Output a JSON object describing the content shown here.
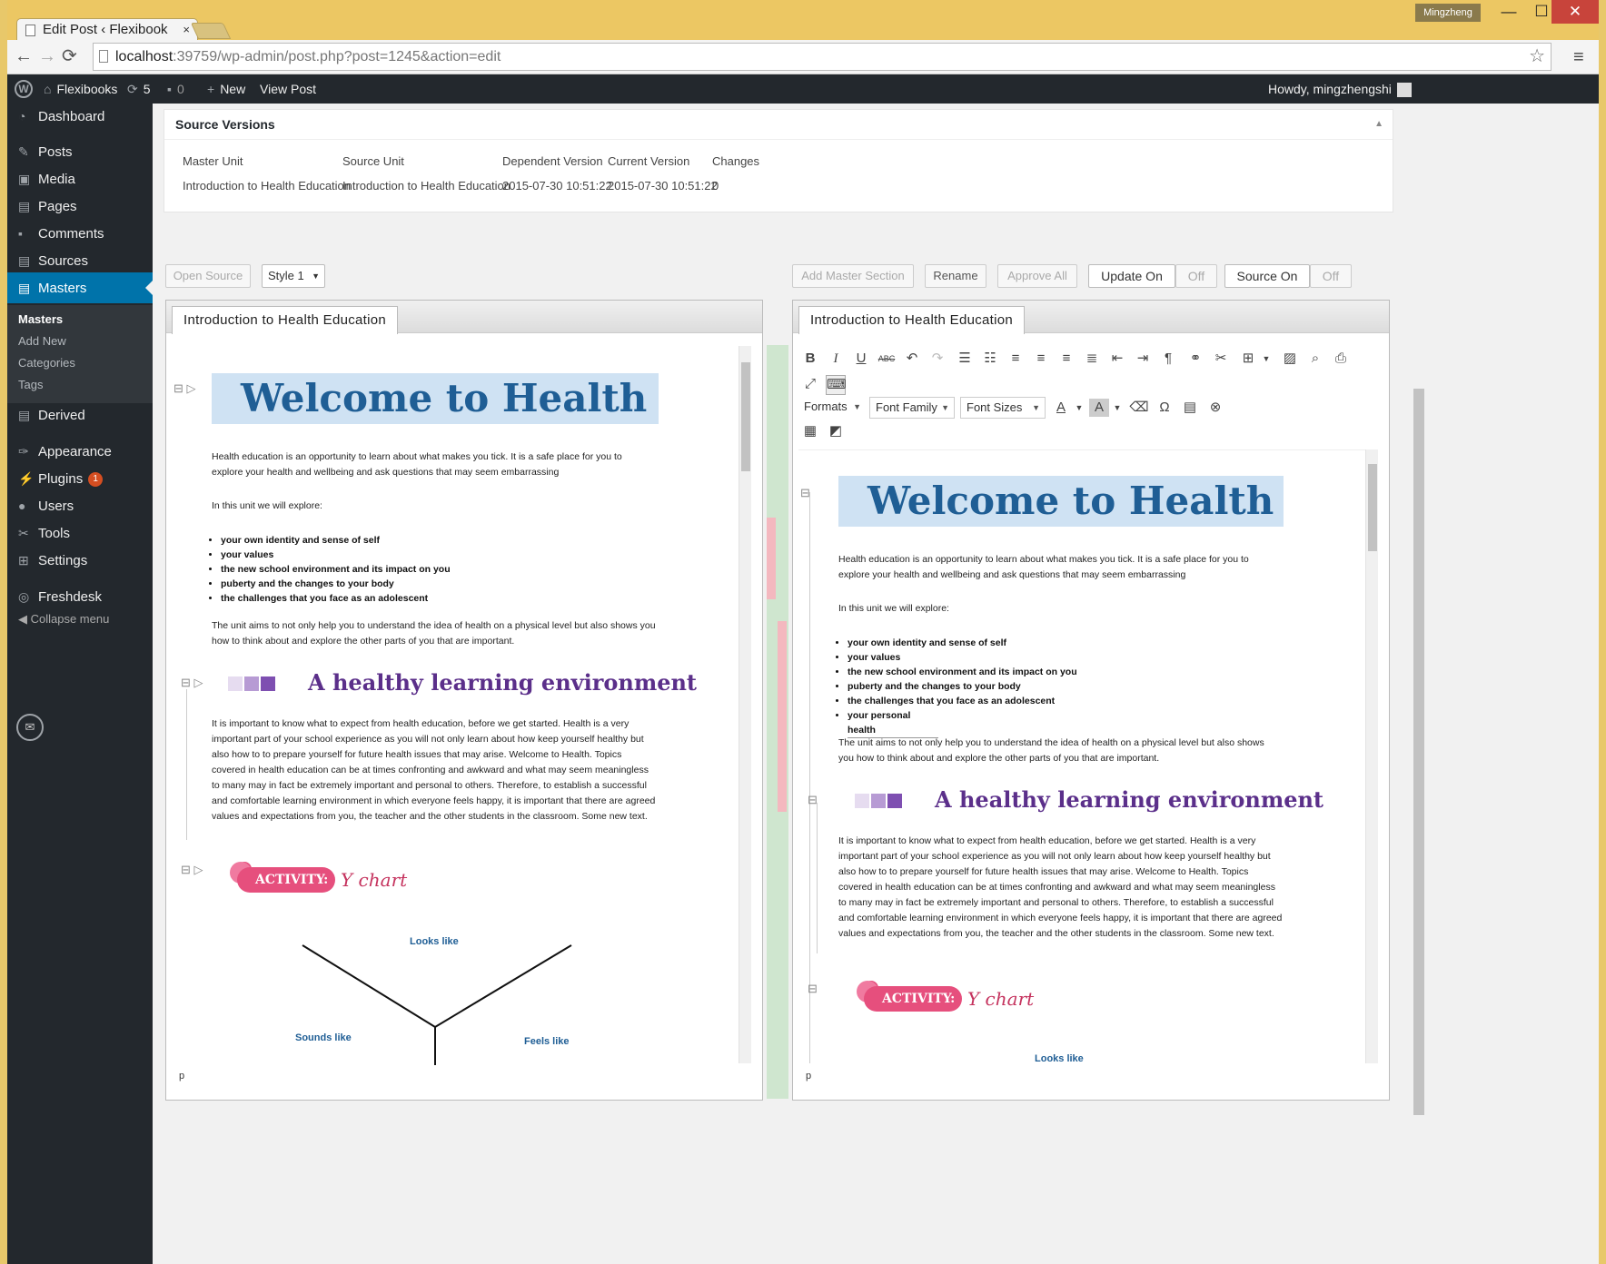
{
  "browser": {
    "tab_title": "Edit Post ‹ Flexibook",
    "tab_close": "×",
    "url_host": "localhost",
    "url_rest": ":39759/wp-admin/post.php?post=1245&action=edit",
    "profile": "Mingzheng",
    "min": "—",
    "max": "☐",
    "close": "✕",
    "back": "←",
    "forward": "→",
    "reload": "⟳",
    "star": "☆",
    "menu": "≡"
  },
  "adminbar": {
    "site": "Flexibooks",
    "updates": "5",
    "comments": "0",
    "new": "New",
    "view": "View Post",
    "howdy": "Howdy, mingzhengshi"
  },
  "sidebar": {
    "items": [
      "Dashboard",
      "Posts",
      "Media",
      "Pages",
      "Comments",
      "Sources",
      "Masters",
      "Derived",
      "Appearance",
      "Plugins",
      "Users",
      "Tools",
      "Settings",
      "Freshdesk"
    ],
    "sub": [
      "Masters",
      "Add New",
      "Categories",
      "Tags"
    ],
    "plugins_badge": "1",
    "collapse": "Collapse menu"
  },
  "source_versions": {
    "title": "Source Versions",
    "headers": [
      "Master Unit",
      "Source Unit",
      "Dependent Version",
      "Current Version",
      "Changes"
    ],
    "row": [
      "Introduction to Health Education",
      "Introduction to Health Education",
      "2015-07-30 10:51:22",
      "2015-07-30 10:51:22",
      "0"
    ]
  },
  "toolbar": {
    "open_source": "Open Source",
    "style": "Style 1",
    "add_master": "Add Master Section",
    "rename": "Rename",
    "approve_all": "Approve All",
    "update_on": "Update On",
    "update_off": "Off",
    "source_on": "Source On",
    "source_off": "Off"
  },
  "left": {
    "tab": "Introduction to Health Education",
    "status": "p"
  },
  "right": {
    "tab": "Introduction to Health Education",
    "status": "p",
    "formats": "Formats",
    "font_family": "Font Family",
    "font_sizes": "Font Sizes",
    "font_color": "A",
    "bg_color": "A"
  },
  "doc": {
    "banner": "Welcome to Health",
    "intro": "Health education is an opportunity to learn about what makes you tick. It is a safe place for you to explore your health and wellbeing and ask questions that may seem embarrassing",
    "explore": "In this unit we will explore:",
    "bullets": [
      "your own identity and sense of self",
      "your values",
      "the new school environment and its impact on you",
      "puberty and the changes to your body",
      "the challenges that you face as an adolescent"
    ],
    "extra_bullet": "your personal health",
    "aims": "The unit aims to not only help you to understand the idea of health on a physical level but also shows you how to think about and explore the other parts of you that are important.",
    "h2": "A healthy learning environment",
    "body": "It is important to know what to expect from health education, before we get started. Health is a very important part of your school experience as you will not only learn about how keep yourself healthy but also how to to prepare yourself for future health issues that may arise. Welcome to Health. Topics covered in health education can be at times confronting and awkward and what may seem meaningless to many may in fact be extremely important and personal to others. Therefore, to establish a successful and comfortable learning environment in which everyone feels happy, it is important that there are agreed values and expectations from you, the teacher and the other students in the classroom. Some new text.",
    "activity": "ACTIVITY:",
    "ychart": "Y chart",
    "looks": "Looks like",
    "sounds": "Sounds like",
    "feels": "Feels like"
  },
  "colors": {
    "wp_dark": "#23282d",
    "wp_blue": "#0073aa",
    "banner_bg": "#cfe2f3",
    "banner_text": "#1f5e95",
    "h2": "#5b2f8a",
    "activity": "#e64f7d",
    "diff_green": "#cfe6cf",
    "diff_red": "#f4b8bf"
  }
}
